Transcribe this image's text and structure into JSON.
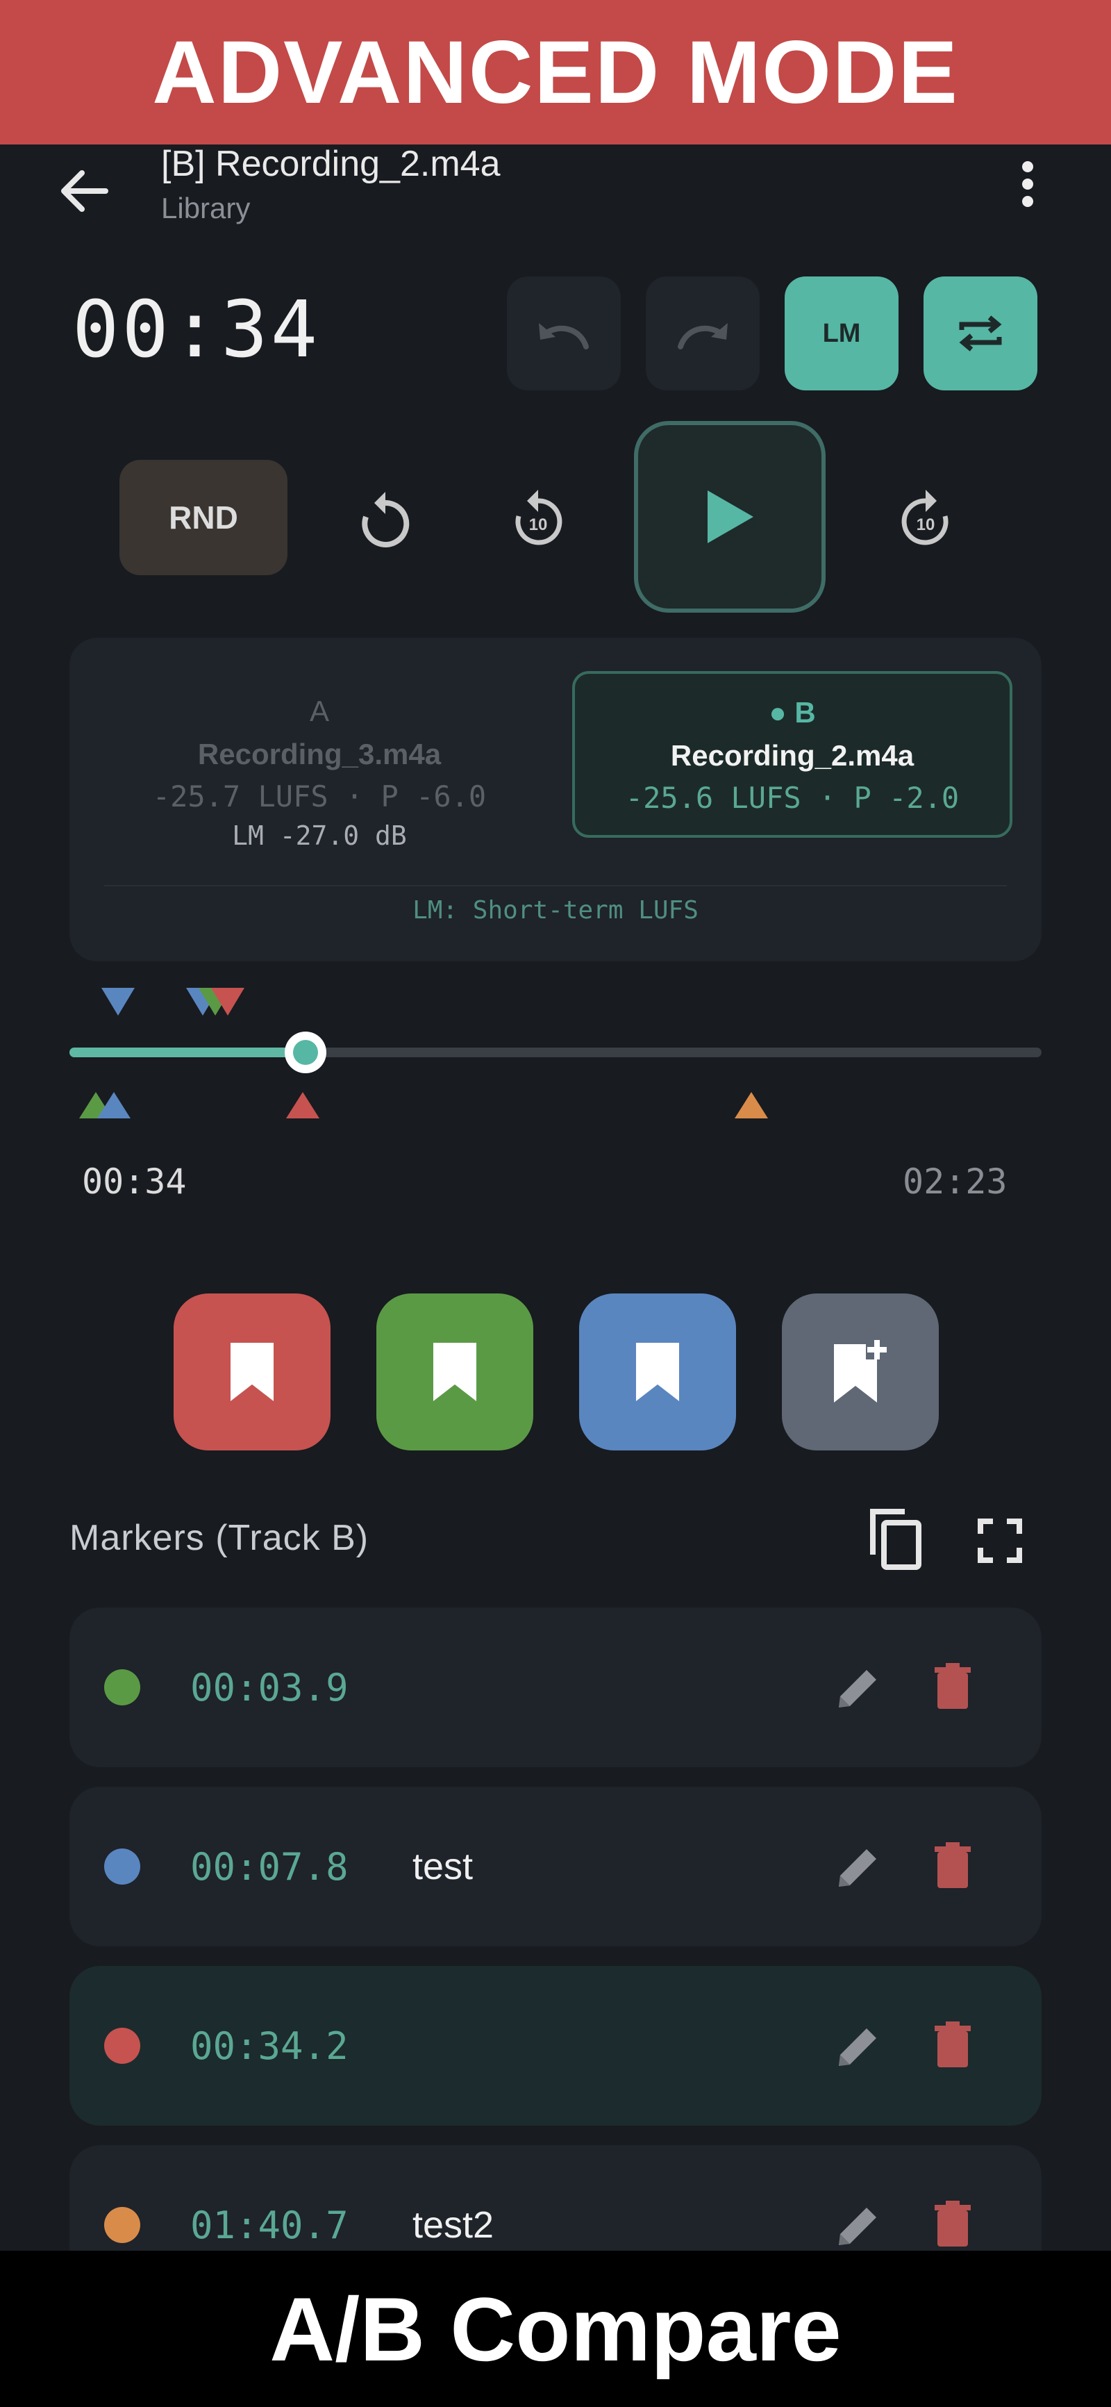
{
  "banners": {
    "top": "ADVANCED MODE",
    "bottom": "A/B Compare"
  },
  "header": {
    "title": "[B] Recording_2.m4a",
    "subtitle": "Library"
  },
  "player": {
    "current_time": "00:34",
    "lm_label": "LM",
    "rnd_label": "RND",
    "skip_label": "10"
  },
  "tracks": {
    "a": {
      "letter": "A",
      "name": "Recording_3.m4a",
      "stats": "-25.7 LUFS · P -6.0",
      "lm": "LM -27.0 dB"
    },
    "b": {
      "letter": "● B",
      "name": "Recording_2.m4a",
      "stats": "-25.6 LUFS · P -2.0"
    },
    "footer": "LM: Short-term LUFS"
  },
  "seek": {
    "position": "00:34",
    "duration": "02:23",
    "progress_fraction": 0.24
  },
  "markers_section": {
    "title": "Markers (Track B)"
  },
  "markers": [
    {
      "time": "00:03.9",
      "label": "",
      "color": "#5b9a45"
    },
    {
      "time": "00:07.8",
      "label": "test",
      "color": "#5a86c0"
    },
    {
      "time": "00:34.2",
      "label": "",
      "color": "#c65350"
    },
    {
      "time": "01:40.7",
      "label": "test2",
      "color": "#d98c4a"
    }
  ],
  "colors": {
    "accent": "#56b7a4",
    "red": "#c65350",
    "green": "#5b9a45",
    "blue": "#5a86c0",
    "gray": "#5f6874",
    "orange": "#d98c4a",
    "delete": "#b45252"
  }
}
